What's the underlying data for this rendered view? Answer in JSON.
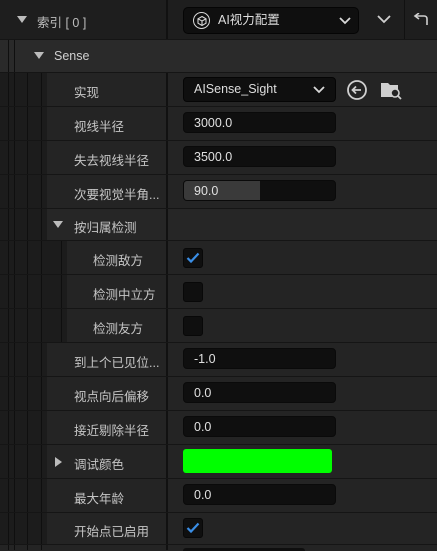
{
  "header": {
    "index_label": "索引 [ 0 ]",
    "config_value": "AI视力配置"
  },
  "section": {
    "title": "Sense"
  },
  "rows": {
    "implementation": {
      "label": "实现",
      "value": "AISense_Sight"
    },
    "sight_radius": {
      "label": "视线半径",
      "value": "3000.0"
    },
    "lose_sight_radius": {
      "label": "失去视线半径",
      "value": "3500.0"
    },
    "peripheral_half_angle": {
      "label": "次要视觉半角...",
      "value": "90.0",
      "slider_fraction": 0.5
    },
    "detection_by_affiliation": {
      "label": "按归属检测"
    },
    "detect_enemies": {
      "label": "检测敌方",
      "checked": true
    },
    "detect_neutrals": {
      "label": "检测中立方",
      "checked": false
    },
    "detect_friendlies": {
      "label": "检测友方",
      "checked": false
    },
    "auto_success_range": {
      "label": "到上个已见位...",
      "value": "-1.0"
    },
    "point_of_view_backward_offset": {
      "label": "视点向后偏移",
      "value": "0.0"
    },
    "near_clipping_radius": {
      "label": "接近剔除半径",
      "value": "0.0"
    },
    "debug_color": {
      "label": "调试颜色",
      "color": "#00ff00"
    },
    "max_age": {
      "label": "最大年龄",
      "value": "0.0"
    },
    "starts_enabled": {
      "label": "开始点已启用",
      "checked": true
    }
  },
  "colors": {
    "accent_check": "#3a8ee6",
    "row_bg": "#242424",
    "field_bg": "#0f0f0f"
  }
}
